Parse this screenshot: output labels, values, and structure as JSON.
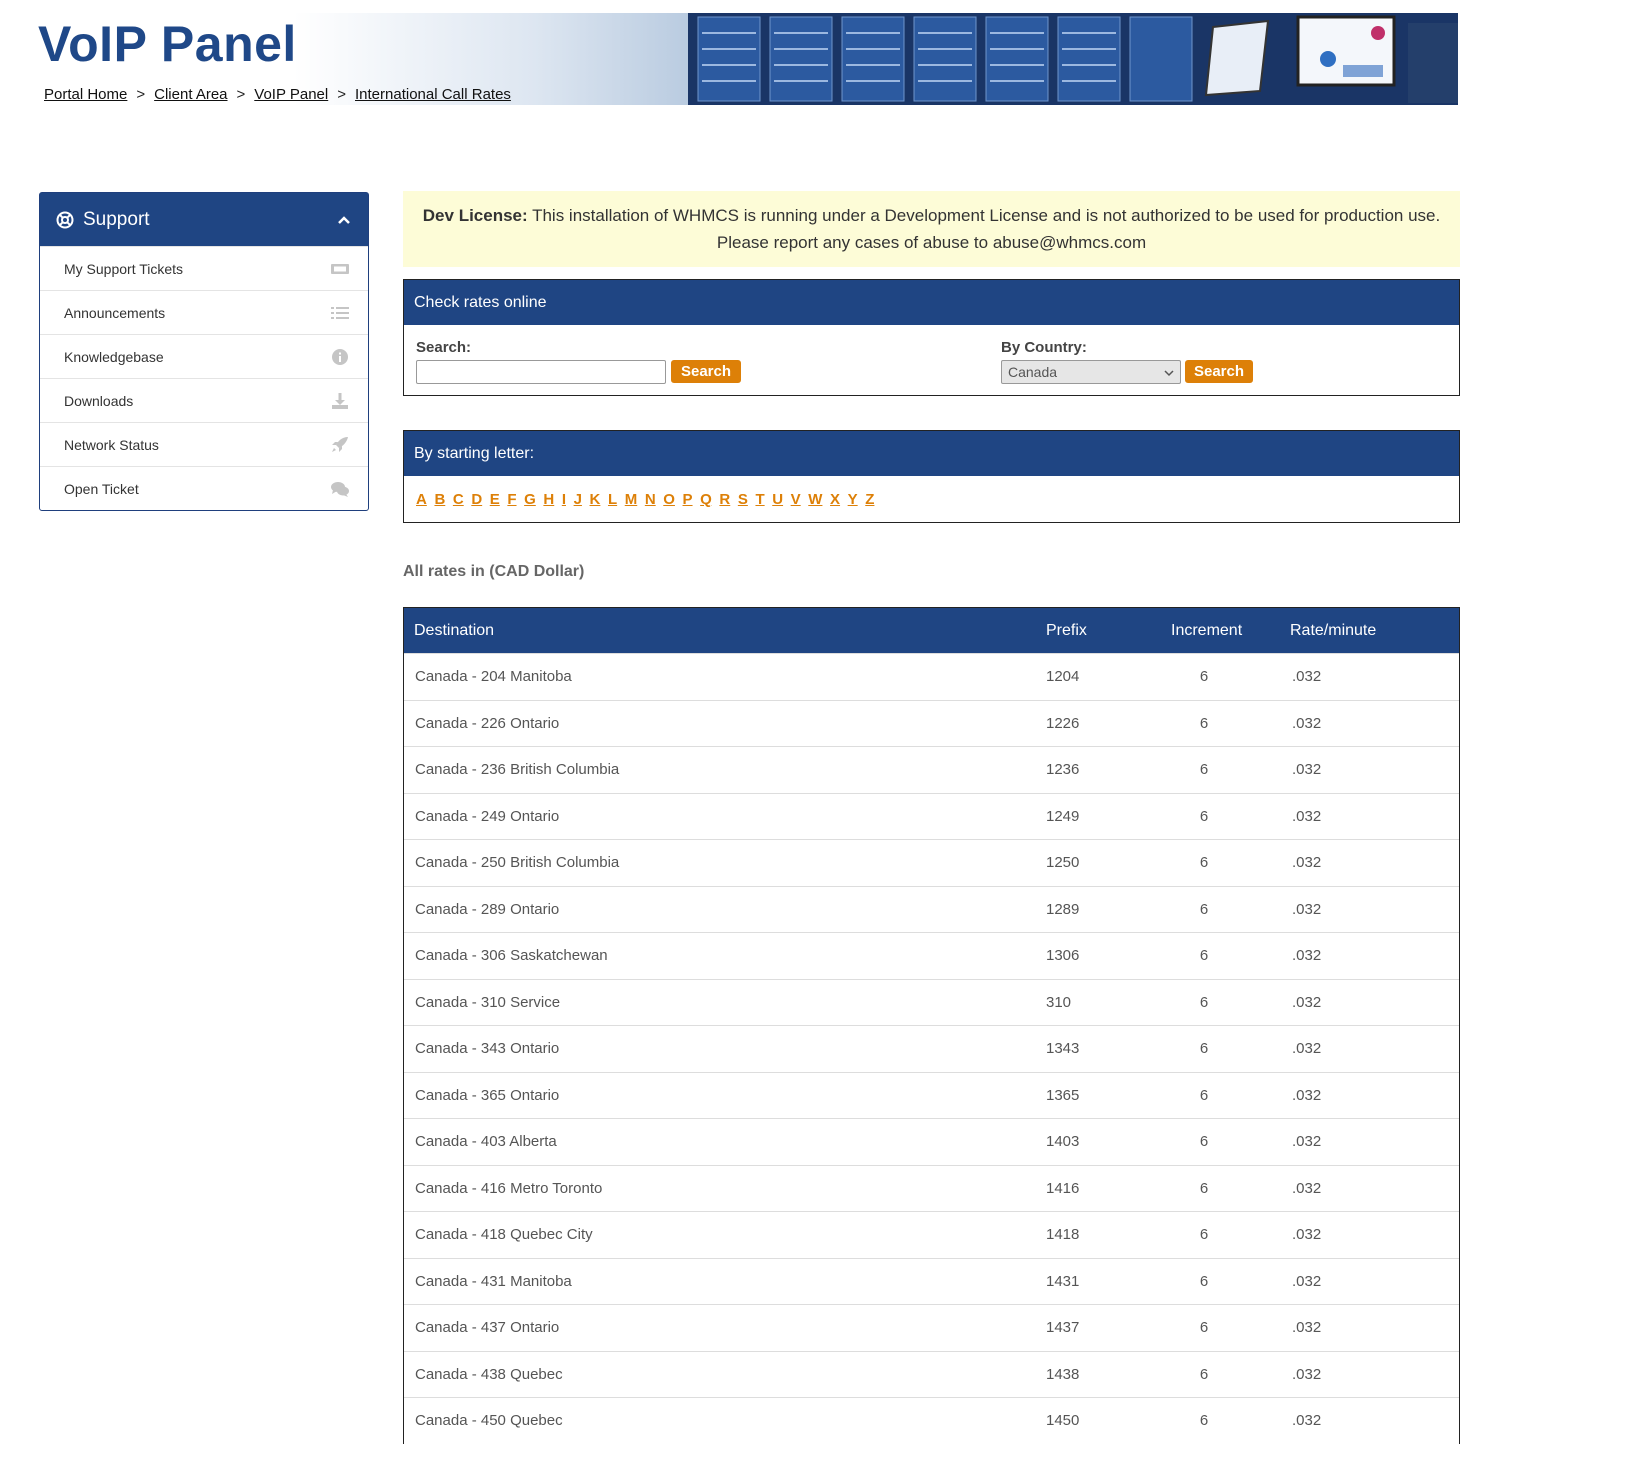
{
  "header": {
    "title": "VoIP Panel",
    "breadcrumb": [
      "Portal Home",
      "Client Area",
      "VoIP Panel",
      "International Call Rates"
    ],
    "separator": ">"
  },
  "sidebar": {
    "title": "Support",
    "items": [
      {
        "label": "My Support Tickets",
        "icon": "ticket-icon"
      },
      {
        "label": "Announcements",
        "icon": "list-icon"
      },
      {
        "label": "Knowledgebase",
        "icon": "info-icon"
      },
      {
        "label": "Downloads",
        "icon": "download-icon"
      },
      {
        "label": "Network Status",
        "icon": "rocket-icon"
      },
      {
        "label": "Open Ticket",
        "icon": "comments-icon"
      }
    ]
  },
  "notice": {
    "bold": "Dev License:",
    "text": "This installation of WHMCS is running under a Development License and is not authorized to be used for production use. Please report any cases of abuse to abuse@whmcs.com"
  },
  "check_rates": {
    "title": "Check rates online",
    "search_label": "Search:",
    "search_value": "",
    "search_button": "Search",
    "country_label": "By Country:",
    "country_value": "Canada",
    "country_button": "Search"
  },
  "letters": {
    "title": "By starting letter:",
    "items": [
      "A",
      "B",
      "C",
      "D",
      "E",
      "F",
      "G",
      "H",
      "I",
      "J",
      "K",
      "L",
      "M",
      "N",
      "O",
      "P",
      "Q",
      "R",
      "S",
      "T",
      "U",
      "V",
      "W",
      "X",
      "Y",
      "Z"
    ]
  },
  "currency_note": "All rates in (CAD Dollar)",
  "table": {
    "headers": [
      "Destination",
      "Prefix",
      "Increment",
      "Rate/minute"
    ],
    "rows": [
      [
        "Canada - 204 Manitoba",
        "1204",
        "6",
        ".032"
      ],
      [
        "Canada - 226 Ontario",
        "1226",
        "6",
        ".032"
      ],
      [
        "Canada - 236 British Columbia",
        "1236",
        "6",
        ".032"
      ],
      [
        "Canada - 249 Ontario",
        "1249",
        "6",
        ".032"
      ],
      [
        "Canada - 250 British Columbia",
        "1250",
        "6",
        ".032"
      ],
      [
        "Canada - 289 Ontario",
        "1289",
        "6",
        ".032"
      ],
      [
        "Canada - 306 Saskatchewan",
        "1306",
        "6",
        ".032"
      ],
      [
        "Canada - 310 Service",
        "310",
        "6",
        ".032"
      ],
      [
        "Canada - 343 Ontario",
        "1343",
        "6",
        ".032"
      ],
      [
        "Canada - 365 Ontario",
        "1365",
        "6",
        ".032"
      ],
      [
        "Canada - 403 Alberta",
        "1403",
        "6",
        ".032"
      ],
      [
        "Canada - 416 Metro Toronto",
        "1416",
        "6",
        ".032"
      ],
      [
        "Canada - 418 Quebec City",
        "1418",
        "6",
        ".032"
      ],
      [
        "Canada - 431 Manitoba",
        "1431",
        "6",
        ".032"
      ],
      [
        "Canada - 437 Ontario",
        "1437",
        "6",
        ".032"
      ],
      [
        "Canada - 438 Quebec",
        "1438",
        "6",
        ".032"
      ],
      [
        "Canada - 450 Quebec",
        "1450",
        "6",
        ".032"
      ]
    ]
  },
  "colors": {
    "brand_blue": "#1f4583",
    "title_blue": "#1f4888",
    "accent_orange": "#dd8008",
    "notice_bg": "#fdfcd7"
  }
}
